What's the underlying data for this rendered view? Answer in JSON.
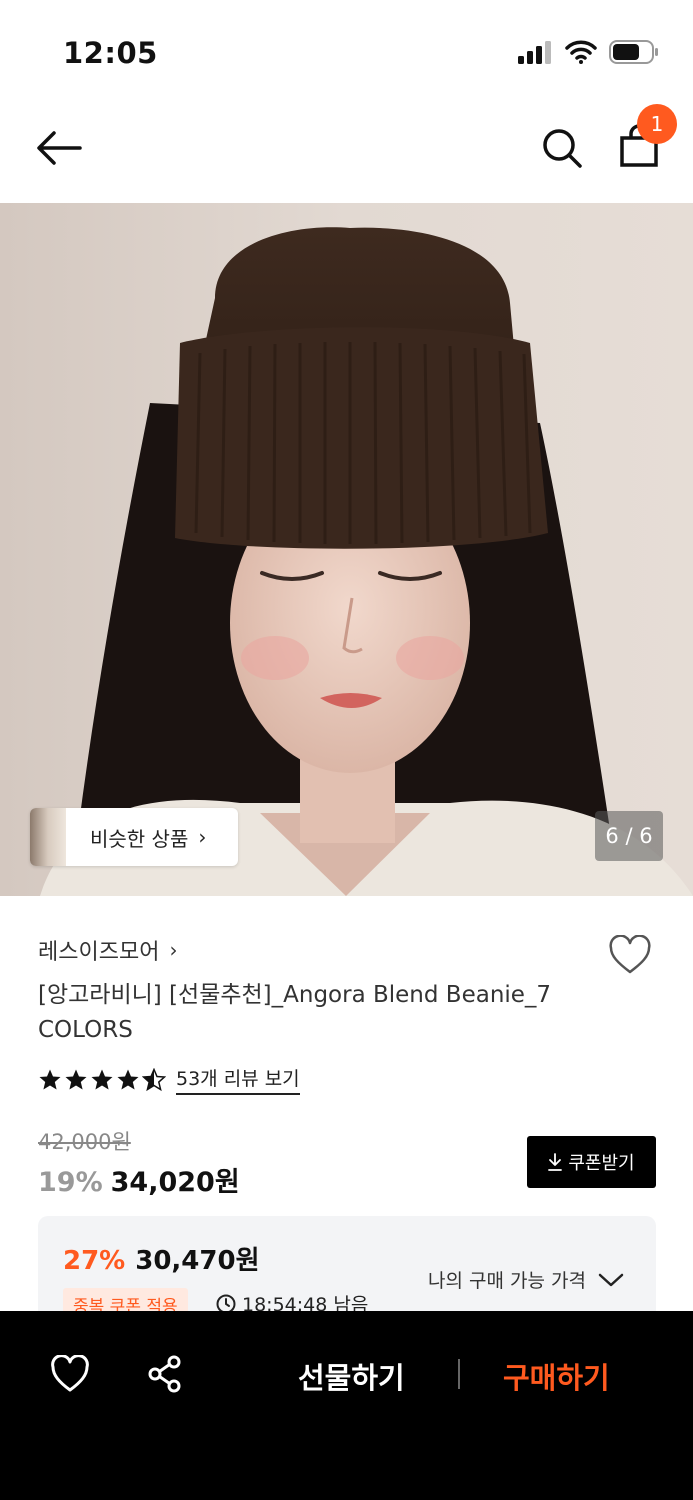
{
  "status_bar": {
    "time": "12:05"
  },
  "header": {
    "cart_count": "1"
  },
  "gallery": {
    "similar_label": "비슷한 상품",
    "page_counter": "6 / 6"
  },
  "product": {
    "brand": "레스이즈모어",
    "title": "[앙고라비니] [선물추천]_Angora Blend Beanie_7 COLORS",
    "rating_value": 4.5,
    "review_link": "53개 리뷰 보기",
    "original_price": "42,000원",
    "discount_percent": "19%",
    "sale_price": "34,020원",
    "coupon_button": "쿠폰받기"
  },
  "best_price": {
    "percent": "27%",
    "price": "30,470원",
    "my_price_label": "나의 구매 가능 가격",
    "coupon_badge": "중복 쿠폰 적용",
    "timer": "18:54:48 남음"
  },
  "bottom_bar": {
    "gift_label": "선물하기",
    "buy_label": "구매하기"
  },
  "colors": {
    "accent": "#ff5a1f",
    "black": "#000000"
  }
}
